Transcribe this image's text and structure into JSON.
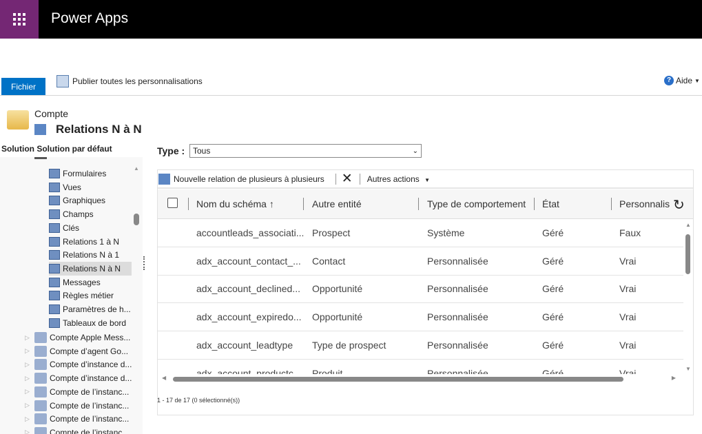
{
  "app": {
    "title": "Power Apps"
  },
  "ribbon": {
    "file": "Fichier",
    "publish": "Publier toutes les personnalisations",
    "help": "Aide"
  },
  "header": {
    "entity": "Compte",
    "title": "Relations N à N",
    "solution": "Solution Solution par défaut"
  },
  "tree": {
    "items": [
      {
        "label": "Formulaires",
        "selected": false
      },
      {
        "label": "Vues",
        "selected": false
      },
      {
        "label": "Graphiques",
        "selected": false
      },
      {
        "label": "Champs",
        "selected": false
      },
      {
        "label": "Clés",
        "selected": false
      },
      {
        "label": "Relations 1 à N",
        "selected": false
      },
      {
        "label": "Relations N à 1",
        "selected": false
      },
      {
        "label": "Relations N à N",
        "selected": true
      },
      {
        "label": "Messages",
        "selected": false
      },
      {
        "label": "Règles métier",
        "selected": false
      },
      {
        "label": "Paramètres de h...",
        "selected": false
      },
      {
        "label": "Tableaux de bord",
        "selected": false
      }
    ],
    "entities": [
      "Compte Apple Mess...",
      "Compte d’agent Go...",
      "Compte d’instance d...",
      "Compte d’instance d...",
      "Compte de l’instanc...",
      "Compte de l’instanc...",
      "Compte de l’instanc...",
      "Compte de l’instanc..."
    ]
  },
  "filter": {
    "label": "Type :",
    "value": "Tous"
  },
  "toolbar": {
    "new": "Nouvelle relation de plusieurs à plusieurs",
    "more": "Autres actions"
  },
  "grid": {
    "columns": [
      "Nom du schéma",
      "Autre entité",
      "Type de comportement",
      "État",
      "Personnalis"
    ],
    "rows": [
      [
        "accountleads_associati...",
        "Prospect",
        "Système",
        "Géré",
        "Faux"
      ],
      [
        "adx_account_contact_...",
        "Contact",
        "Personnalisée",
        "Géré",
        "Vrai"
      ],
      [
        "adx_account_declined...",
        "Opportunité",
        "Personnalisée",
        "Géré",
        "Vrai"
      ],
      [
        "adx_account_expiredo...",
        "Opportunité",
        "Personnalisée",
        "Géré",
        "Vrai"
      ],
      [
        "adx_account_leadtype",
        "Type de prospect",
        "Personnalisée",
        "Géré",
        "Vrai"
      ],
      [
        "adx_account_productc...",
        "Produit",
        "Personnalisée",
        "Géré",
        "Vrai"
      ]
    ],
    "footer": "1 - 17  de 17 (0 sélectionné(s))"
  }
}
